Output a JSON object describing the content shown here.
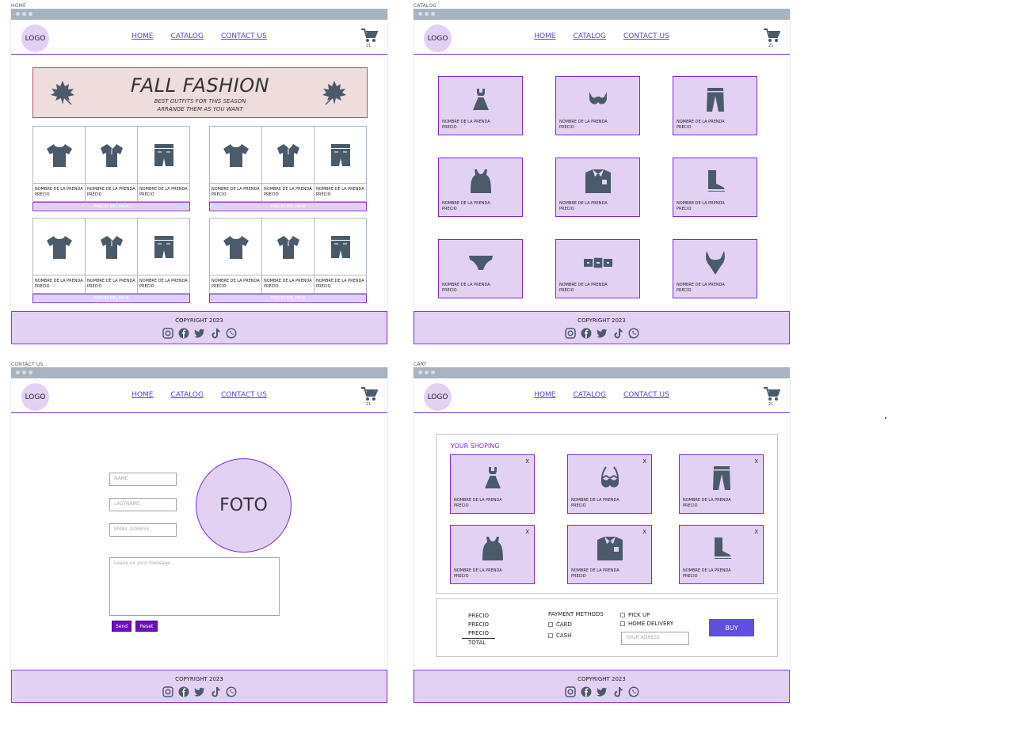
{
  "labels": {
    "home": "HOME",
    "catalog": "CATALOG",
    "contact": "CONTACT US",
    "cart": "CART"
  },
  "nav": {
    "logo": "LOGO",
    "home": "HOME",
    "catalog": "CATALOG",
    "contact": "CONTACT US",
    "cart_count": "21"
  },
  "footer": {
    "copyright": "COPYRIGHT 2023",
    "socials": [
      "instagram-icon",
      "facebook-icon",
      "twitter-icon",
      "tiktok-icon",
      "whatsapp-icon"
    ]
  },
  "hero": {
    "title": "FALL FASHION",
    "subtitle1": "BEST OUTFITS FOR THIS SEASON",
    "subtitle2": "ARRANGE THEM AS YOU WANT"
  },
  "product": {
    "name": "NOMBRE DE LA PRENDA",
    "price": "PRECIO"
  },
  "pack_price": "PRECIO DEL PACK",
  "catalog_items": [
    "dress-icon",
    "bra-icon",
    "pants-icon",
    "tank-top-icon",
    "shirt-tie-icon",
    "boot-icon",
    "underwear-icon",
    "belt-icon",
    "swimsuit-icon"
  ],
  "cart_items": [
    "dress-icon",
    "bra-icon",
    "pants-icon",
    "tank-top-icon",
    "shirt-tie-icon",
    "boot-icon"
  ],
  "contact": {
    "name_ph": "NAME",
    "lastname_ph": "LASTNAME",
    "email_ph": "EMAIL ADRESS",
    "message_ph": "Leave us your message...",
    "photo": "FOTO",
    "send": "Send",
    "reset": "Reset"
  },
  "cart": {
    "heading": "YOUR SHOPING",
    "remove": "X",
    "prices": [
      "PRECIO",
      "PRECIO",
      "PRECIO"
    ],
    "total": "TOTAL",
    "payment_label": "PAYMENT METHODS",
    "card": "CARD",
    "cash": "CASH",
    "pickup": "PICK UP",
    "delivery": "HOME DELIVERY",
    "address_ph": "YOUR ADRESS",
    "buy": "BUY"
  },
  "colors": {
    "accent": "#7d2bd1",
    "tile": "#e3d1f4",
    "icon": "#4a5a6a",
    "buy": "#5f4fe0",
    "titlebar": "#a7b3bf"
  }
}
